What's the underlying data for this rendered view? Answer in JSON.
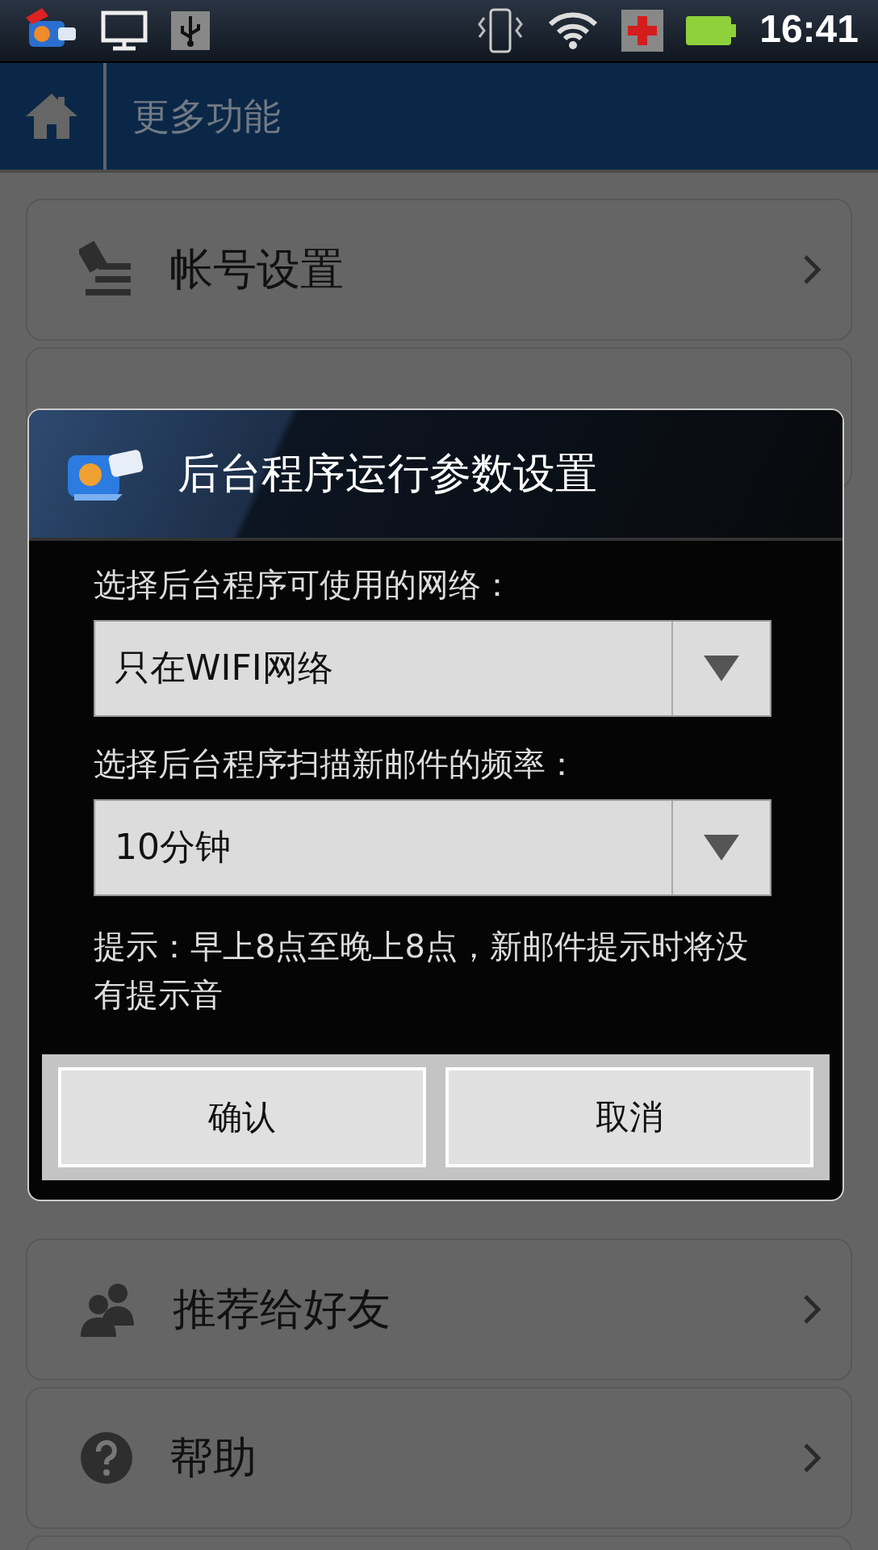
{
  "status_bar": {
    "time": "16:41"
  },
  "header": {
    "title": "更多功能"
  },
  "menu_items": [
    {
      "label": "帐号设置",
      "kind": "account"
    },
    {
      "label": "推荐给好友",
      "kind": "people"
    },
    {
      "label": "帮助",
      "kind": "help"
    }
  ],
  "dialog": {
    "title": "后台程序运行参数设置",
    "fields": [
      {
        "label": "选择后台程序可使用的网络：",
        "value": "只在WIFI网络"
      },
      {
        "label": "选择后台程序扫描新邮件的频率：",
        "value": "10分钟"
      }
    ],
    "hint": "提示：早上8点至晚上8点，新邮件提示时将没有提示音",
    "buttons": [
      "确认",
      "取消"
    ]
  }
}
